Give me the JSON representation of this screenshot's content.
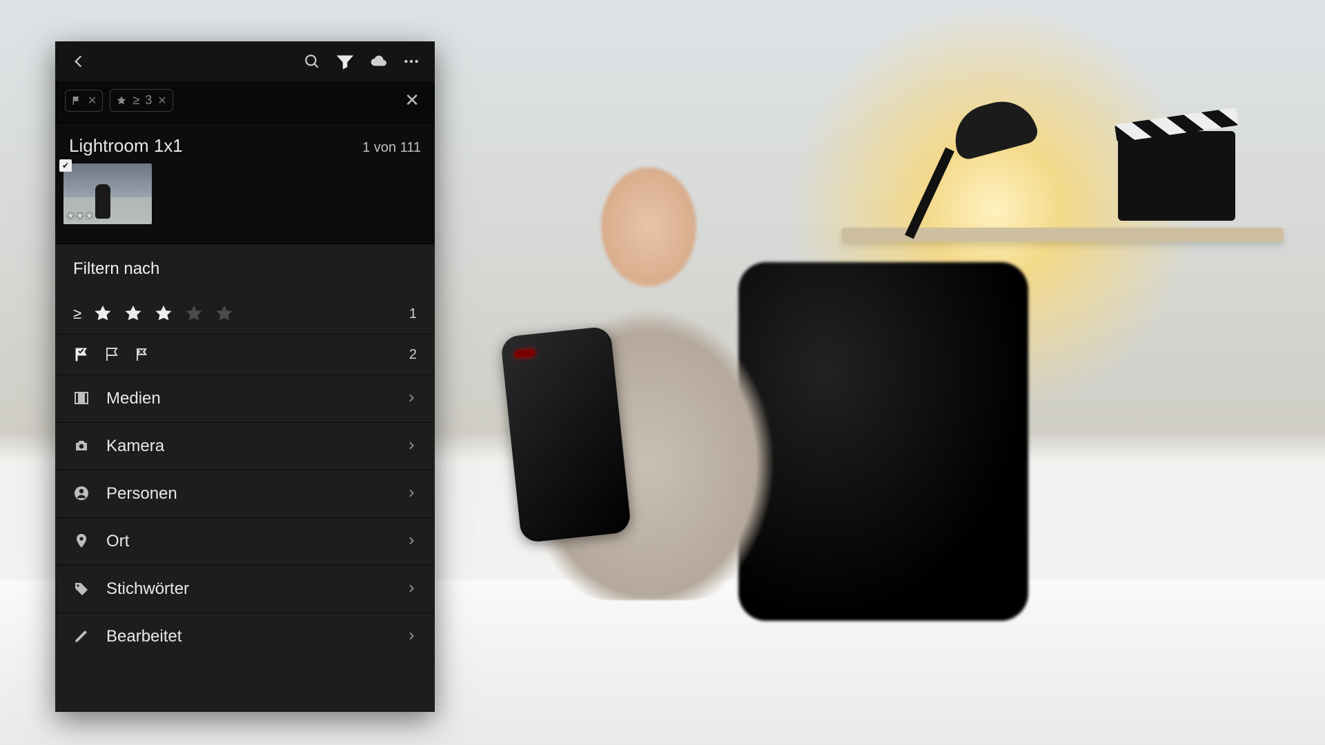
{
  "background": {
    "description": "Young man seated at a white desk in a home office, holding a black smartphone with both hands and looking at its screen. A bright desk lamp, wooden shelf, film clapperboard and plant are visible behind him to the right; a black mesh office chair is behind him.",
    "accent_light": "#fde9a8"
  },
  "app": {
    "name": "Adobe Lightroom Mobile",
    "topbar": {
      "back_icon": "chevron-left",
      "icons": [
        "search",
        "filter",
        "cloud",
        "more"
      ]
    },
    "active_filters": [
      {
        "kind": "flag-picked"
      },
      {
        "kind": "rating",
        "operator": "≥",
        "value": 3
      }
    ],
    "album": {
      "title": "Lightroom 1x1",
      "count_text": "1 von 111",
      "thumbnail": {
        "picked": true,
        "rating": 3
      }
    },
    "filter_sheet": {
      "title": "Filtern nach",
      "rating": {
        "operator": "≥",
        "stars_filled": 3,
        "stars_total": 5,
        "match_count": 1
      },
      "flags": {
        "states": [
          "picked",
          "unflagged",
          "rejected"
        ],
        "match_count": 2
      },
      "categories": [
        {
          "icon": "film",
          "label": "Medien"
        },
        {
          "icon": "camera",
          "label": "Kamera"
        },
        {
          "icon": "person",
          "label": "Personen"
        },
        {
          "icon": "pin",
          "label": "Ort"
        },
        {
          "icon": "tag",
          "label": "Stichwörter"
        },
        {
          "icon": "pencil",
          "label": "Bearbeitet"
        }
      ]
    }
  },
  "colors": {
    "panel_bg": "#141414",
    "sheet_bg": "#1d1d1d",
    "text": "#e6e6e6",
    "muted": "#8a8a8a"
  }
}
